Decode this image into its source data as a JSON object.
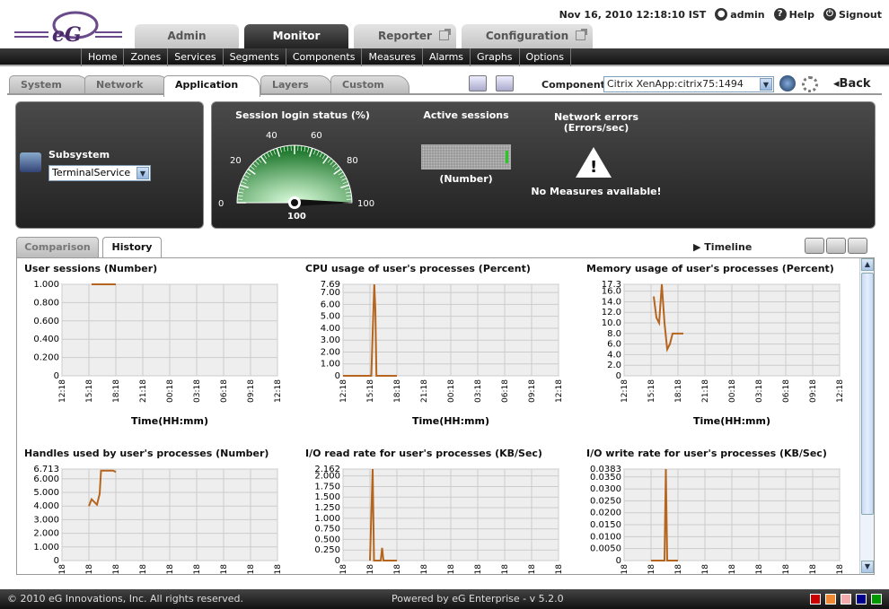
{
  "header": {
    "date": "Nov 16, 2010 12:18:10 IST",
    "user": "admin",
    "help": "Help",
    "signout": "Signout"
  },
  "brand": {
    "logo_text": "eG"
  },
  "main_tabs": [
    {
      "label": "Admin"
    },
    {
      "label": "Monitor"
    },
    {
      "label": "Reporter"
    },
    {
      "label": "Configuration"
    }
  ],
  "subnav": [
    "Home",
    "Zones",
    "Services",
    "Segments",
    "Components",
    "Measures",
    "Alarms",
    "Graphs",
    "Options"
  ],
  "category_tabs": [
    "System",
    "Network",
    "Application",
    "Layers",
    "Custom"
  ],
  "component": {
    "label": "Component",
    "value": "Citrix XenApp:citrix75:1494",
    "back": "Back"
  },
  "subsystem": {
    "label": "Subsystem",
    "value": "TerminalService"
  },
  "gauge": {
    "title": "Session login status (%)",
    "value": 100,
    "ticks": [
      "0",
      "20",
      "40",
      "60",
      "80",
      "100"
    ],
    "value_label": "100"
  },
  "active_sessions": {
    "title": "Active sessions",
    "unit": "(Number)"
  },
  "network_errors": {
    "title": "Network errors",
    "subtitle": "(Errors/sec)",
    "message": "No Measures available!"
  },
  "bottom_tabs": [
    "Comparison",
    "History"
  ],
  "timeline": "Timeline",
  "time_ticks": [
    "12:18",
    "15:18",
    "18:18",
    "21:18",
    "00:18",
    "03:18",
    "06:18",
    "09:18",
    "12:18"
  ],
  "xlabel": "Time(HH:mm)",
  "chart_data": [
    {
      "type": "line",
      "title": "User sessions (Number)",
      "xlabel": "Time(HH:mm)",
      "y_ticks": [
        "0",
        "0.200",
        "0.400",
        "0.600",
        "0.800",
        "1.000"
      ],
      "ylim": [
        0,
        1.0
      ],
      "series": [
        {
          "values": [
            [
              1.1,
              1.0
            ],
            [
              2.0,
              1.0
            ]
          ]
        }
      ]
    },
    {
      "type": "line",
      "title": "CPU usage of user's processes (Percent)",
      "xlabel": "Time(HH:mm)",
      "y_ticks": [
        "0",
        "1.00",
        "2.00",
        "3.00",
        "4.00",
        "5.00",
        "6.00",
        "7.00",
        "7.69"
      ],
      "ylim": [
        0,
        7.69
      ],
      "series": [
        {
          "values": [
            [
              0.0,
              0
            ],
            [
              1.05,
              0
            ],
            [
              1.12,
              5
            ],
            [
              1.16,
              7.69
            ],
            [
              1.2,
              5.6
            ],
            [
              1.24,
              0
            ],
            [
              2.0,
              0
            ]
          ]
        }
      ]
    },
    {
      "type": "line",
      "title": "Memory usage of user's processes (Percent)",
      "xlabel": "Time(HH:mm)",
      "y_ticks": [
        "0",
        "2.0",
        "4.0",
        "6.0",
        "8.0",
        "10.0",
        "12.0",
        "14.0",
        "16.0",
        "17.3"
      ],
      "ylim": [
        0,
        17.3
      ],
      "series": [
        {
          "values": [
            [
              1.1,
              15
            ],
            [
              1.2,
              11
            ],
            [
              1.3,
              10
            ],
            [
              1.4,
              17.3
            ],
            [
              1.5,
              10
            ],
            [
              1.6,
              5
            ],
            [
              1.7,
              6
            ],
            [
              1.8,
              8
            ],
            [
              2.2,
              8
            ]
          ]
        }
      ]
    },
    {
      "type": "line",
      "title": "Handles used by user's processes (Number)",
      "y_ticks": [
        "0",
        "1.000",
        "2.000",
        "3.000",
        "4.000",
        "5.000",
        "6.000",
        "6.713"
      ],
      "ylim": [
        0,
        6.713
      ],
      "series": [
        {
          "values": [
            [
              1.0,
              4.0
            ],
            [
              1.1,
              4.5
            ],
            [
              1.3,
              4.1
            ],
            [
              1.4,
              4.9
            ],
            [
              1.45,
              6.6
            ],
            [
              1.9,
              6.6
            ],
            [
              2.0,
              6.5
            ]
          ]
        }
      ]
    },
    {
      "type": "line",
      "title": "I/O read rate for user's processes (KB/Sec)",
      "y_ticks": [
        "0",
        "0.250",
        "0.500",
        "0.750",
        "1.000",
        "1.250",
        "1.500",
        "1.750",
        "2.000",
        "2.162"
      ],
      "ylim": [
        0,
        2.162
      ],
      "series": [
        {
          "values": [
            [
              1.0,
              0
            ],
            [
              1.1,
              2.162
            ],
            [
              1.15,
              0
            ],
            [
              1.4,
              0
            ],
            [
              1.45,
              0.3
            ],
            [
              1.5,
              0
            ],
            [
              2.0,
              0
            ]
          ]
        }
      ]
    },
    {
      "type": "line",
      "title": "I/O write rate for user's processes (KB/Sec)",
      "y_ticks": [
        "0",
        "0.0050",
        "0.0100",
        "0.0150",
        "0.0200",
        "0.0250",
        "0.0300",
        "0.0350",
        "0.0383"
      ],
      "ylim": [
        0,
        0.0383
      ],
      "series": [
        {
          "values": [
            [
              1.0,
              0
            ],
            [
              1.5,
              0
            ],
            [
              1.55,
              0.0383
            ],
            [
              1.6,
              0
            ],
            [
              2.0,
              0
            ]
          ]
        }
      ]
    }
  ],
  "footer": {
    "copyright": "© 2010 eG Innovations, Inc. All rights reserved.",
    "powered": "Powered by eG Enterprise  - v 5.2.0"
  },
  "colors": {
    "series": "#b5651d",
    "swatches": [
      "#cc0000",
      "#ee8833",
      "#f4aaaa",
      "#000088",
      "#009900"
    ]
  }
}
